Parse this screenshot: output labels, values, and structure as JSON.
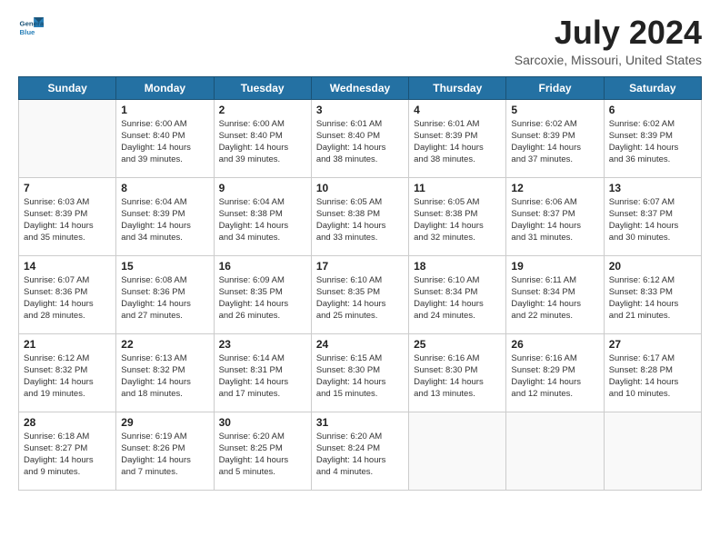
{
  "header": {
    "logo_line1": "General",
    "logo_line2": "Blue",
    "title": "July 2024",
    "subtitle": "Sarcoxie, Missouri, United States"
  },
  "calendar": {
    "days_of_week": [
      "Sunday",
      "Monday",
      "Tuesday",
      "Wednesday",
      "Thursday",
      "Friday",
      "Saturday"
    ],
    "weeks": [
      [
        {
          "day": "",
          "info": ""
        },
        {
          "day": "1",
          "info": "Sunrise: 6:00 AM\nSunset: 8:40 PM\nDaylight: 14 hours\nand 39 minutes."
        },
        {
          "day": "2",
          "info": "Sunrise: 6:00 AM\nSunset: 8:40 PM\nDaylight: 14 hours\nand 39 minutes."
        },
        {
          "day": "3",
          "info": "Sunrise: 6:01 AM\nSunset: 8:40 PM\nDaylight: 14 hours\nand 38 minutes."
        },
        {
          "day": "4",
          "info": "Sunrise: 6:01 AM\nSunset: 8:39 PM\nDaylight: 14 hours\nand 38 minutes."
        },
        {
          "day": "5",
          "info": "Sunrise: 6:02 AM\nSunset: 8:39 PM\nDaylight: 14 hours\nand 37 minutes."
        },
        {
          "day": "6",
          "info": "Sunrise: 6:02 AM\nSunset: 8:39 PM\nDaylight: 14 hours\nand 36 minutes."
        }
      ],
      [
        {
          "day": "7",
          "info": "Sunrise: 6:03 AM\nSunset: 8:39 PM\nDaylight: 14 hours\nand 35 minutes."
        },
        {
          "day": "8",
          "info": "Sunrise: 6:04 AM\nSunset: 8:39 PM\nDaylight: 14 hours\nand 34 minutes."
        },
        {
          "day": "9",
          "info": "Sunrise: 6:04 AM\nSunset: 8:38 PM\nDaylight: 14 hours\nand 34 minutes."
        },
        {
          "day": "10",
          "info": "Sunrise: 6:05 AM\nSunset: 8:38 PM\nDaylight: 14 hours\nand 33 minutes."
        },
        {
          "day": "11",
          "info": "Sunrise: 6:05 AM\nSunset: 8:38 PM\nDaylight: 14 hours\nand 32 minutes."
        },
        {
          "day": "12",
          "info": "Sunrise: 6:06 AM\nSunset: 8:37 PM\nDaylight: 14 hours\nand 31 minutes."
        },
        {
          "day": "13",
          "info": "Sunrise: 6:07 AM\nSunset: 8:37 PM\nDaylight: 14 hours\nand 30 minutes."
        }
      ],
      [
        {
          "day": "14",
          "info": "Sunrise: 6:07 AM\nSunset: 8:36 PM\nDaylight: 14 hours\nand 28 minutes."
        },
        {
          "day": "15",
          "info": "Sunrise: 6:08 AM\nSunset: 8:36 PM\nDaylight: 14 hours\nand 27 minutes."
        },
        {
          "day": "16",
          "info": "Sunrise: 6:09 AM\nSunset: 8:35 PM\nDaylight: 14 hours\nand 26 minutes."
        },
        {
          "day": "17",
          "info": "Sunrise: 6:10 AM\nSunset: 8:35 PM\nDaylight: 14 hours\nand 25 minutes."
        },
        {
          "day": "18",
          "info": "Sunrise: 6:10 AM\nSunset: 8:34 PM\nDaylight: 14 hours\nand 24 minutes."
        },
        {
          "day": "19",
          "info": "Sunrise: 6:11 AM\nSunset: 8:34 PM\nDaylight: 14 hours\nand 22 minutes."
        },
        {
          "day": "20",
          "info": "Sunrise: 6:12 AM\nSunset: 8:33 PM\nDaylight: 14 hours\nand 21 minutes."
        }
      ],
      [
        {
          "day": "21",
          "info": "Sunrise: 6:12 AM\nSunset: 8:32 PM\nDaylight: 14 hours\nand 19 minutes."
        },
        {
          "day": "22",
          "info": "Sunrise: 6:13 AM\nSunset: 8:32 PM\nDaylight: 14 hours\nand 18 minutes."
        },
        {
          "day": "23",
          "info": "Sunrise: 6:14 AM\nSunset: 8:31 PM\nDaylight: 14 hours\nand 17 minutes."
        },
        {
          "day": "24",
          "info": "Sunrise: 6:15 AM\nSunset: 8:30 PM\nDaylight: 14 hours\nand 15 minutes."
        },
        {
          "day": "25",
          "info": "Sunrise: 6:16 AM\nSunset: 8:30 PM\nDaylight: 14 hours\nand 13 minutes."
        },
        {
          "day": "26",
          "info": "Sunrise: 6:16 AM\nSunset: 8:29 PM\nDaylight: 14 hours\nand 12 minutes."
        },
        {
          "day": "27",
          "info": "Sunrise: 6:17 AM\nSunset: 8:28 PM\nDaylight: 14 hours\nand 10 minutes."
        }
      ],
      [
        {
          "day": "28",
          "info": "Sunrise: 6:18 AM\nSunset: 8:27 PM\nDaylight: 14 hours\nand 9 minutes."
        },
        {
          "day": "29",
          "info": "Sunrise: 6:19 AM\nSunset: 8:26 PM\nDaylight: 14 hours\nand 7 minutes."
        },
        {
          "day": "30",
          "info": "Sunrise: 6:20 AM\nSunset: 8:25 PM\nDaylight: 14 hours\nand 5 minutes."
        },
        {
          "day": "31",
          "info": "Sunrise: 6:20 AM\nSunset: 8:24 PM\nDaylight: 14 hours\nand 4 minutes."
        },
        {
          "day": "",
          "info": ""
        },
        {
          "day": "",
          "info": ""
        },
        {
          "day": "",
          "info": ""
        }
      ]
    ]
  }
}
